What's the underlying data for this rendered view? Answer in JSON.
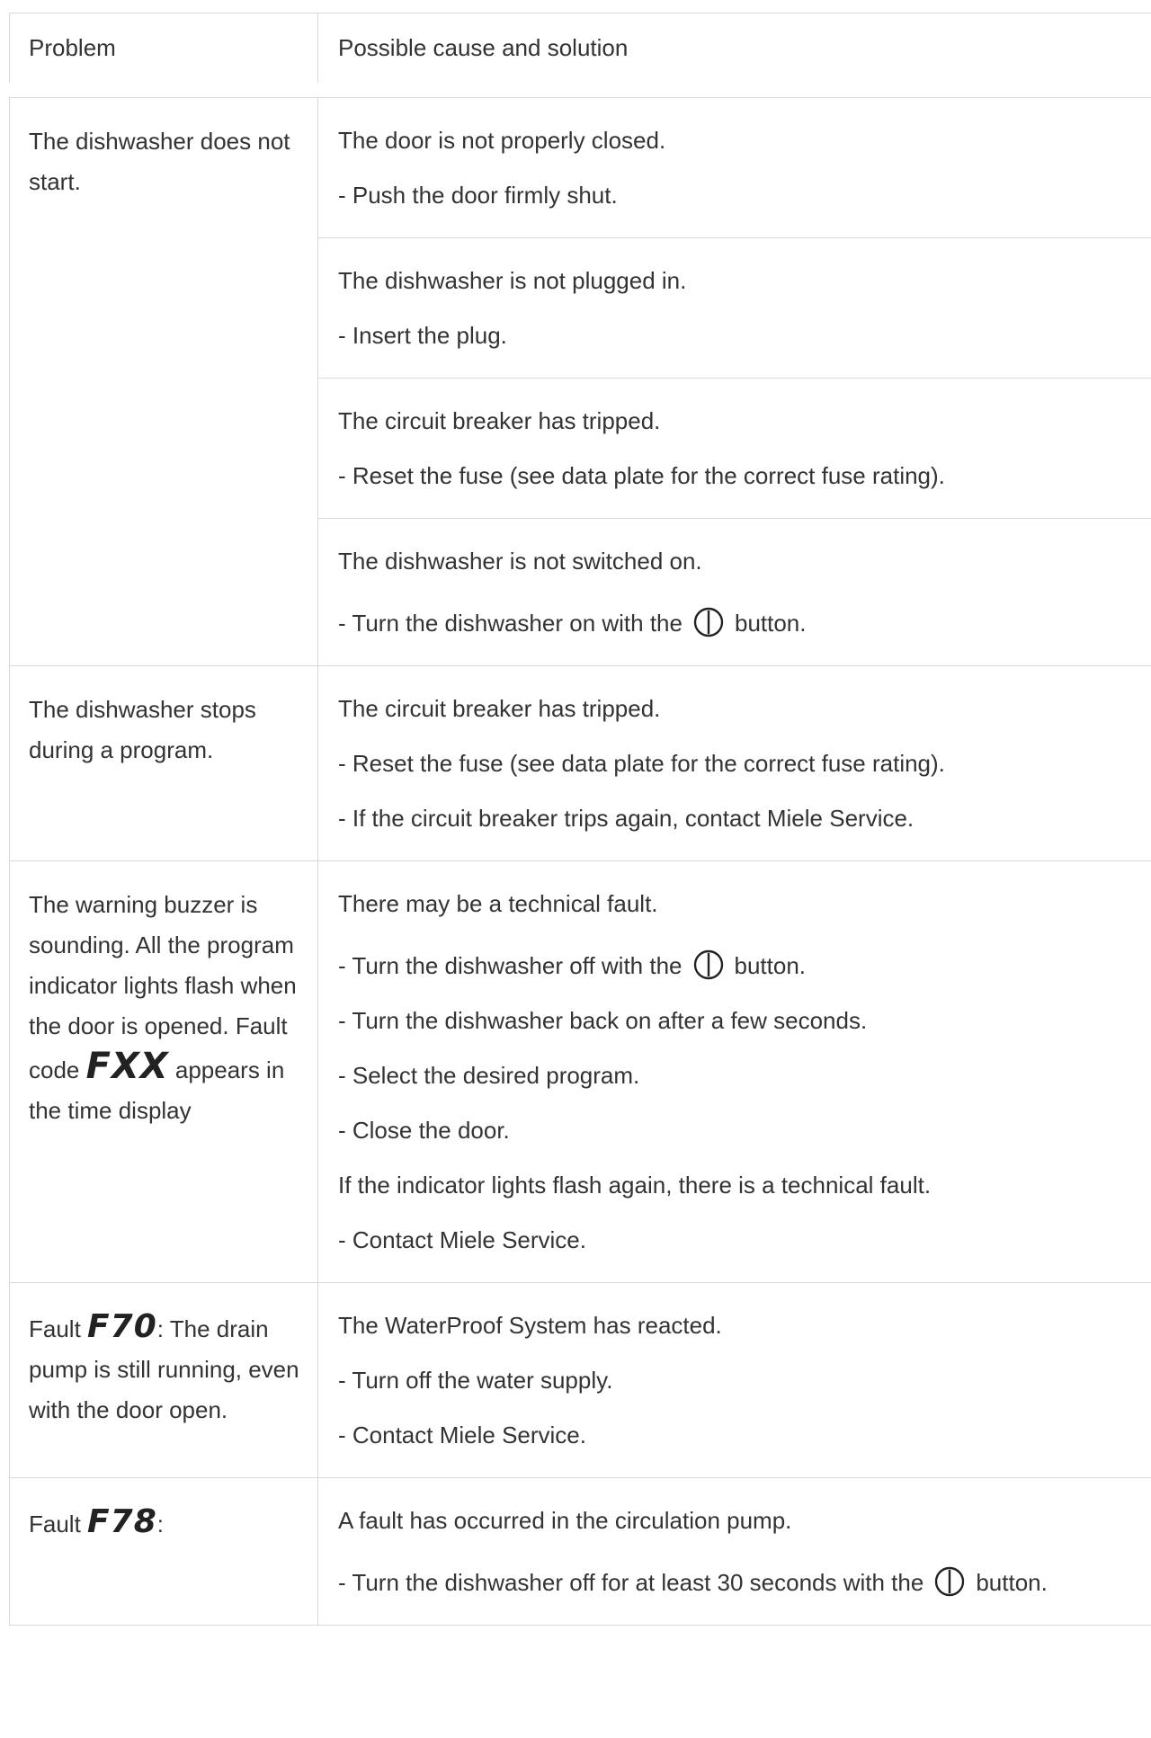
{
  "header": {
    "problem": "Problem",
    "solution": "Possible cause and solution"
  },
  "rows": [
    {
      "problem": "The dishwasher does not start.",
      "solutions": [
        [
          "The door is not properly closed.",
          "- Push the door firmly shut."
        ],
        [
          "The dishwasher is not plugged in.",
          "- Insert the plug."
        ],
        [
          "The circuit breaker has tripped.",
          "- Reset the fuse (see data plate for the correct fuse rating)."
        ],
        [
          "The dishwasher is not switched on.",
          "- Turn the dishwasher on with the",
          "button."
        ]
      ]
    },
    {
      "problem": "The dishwasher stops during a program.",
      "solutions": [
        [
          "The circuit breaker has tripped.",
          "- Reset the fuse (see data plate for the correct fuse rating).",
          "- If the circuit breaker trips again, contact Miele Service."
        ]
      ]
    },
    {
      "problem_parts": [
        "The warning buzzer is sounding. All the program indicator lights flash when the door is opened. Fault code",
        "FXX",
        "appears in the time display"
      ],
      "solutions": [
        [
          "There may be a technical fault.",
          "- Turn the dishwasher off with the",
          "button.",
          "- Turn the dishwasher back on after a few seconds.",
          "- Select the desired program.",
          "- Close the door.",
          "If the indicator lights flash again, there is a technical fault.",
          "- Contact Miele Service."
        ]
      ]
    },
    {
      "problem_parts": [
        "Fault",
        "F70",
        ": The drain pump is still running, even with the door open."
      ],
      "solutions": [
        [
          "The WaterProof System has reacted.",
          "- Turn off the water supply.",
          "- Contact Miele Service."
        ]
      ]
    },
    {
      "problem_parts": [
        "Fault",
        "F78",
        ":"
      ],
      "solutions": [
        [
          "A fault has occurred in the circulation pump.",
          "- Turn the dishwasher off for at least 30 seconds with the",
          "button."
        ]
      ]
    }
  ]
}
